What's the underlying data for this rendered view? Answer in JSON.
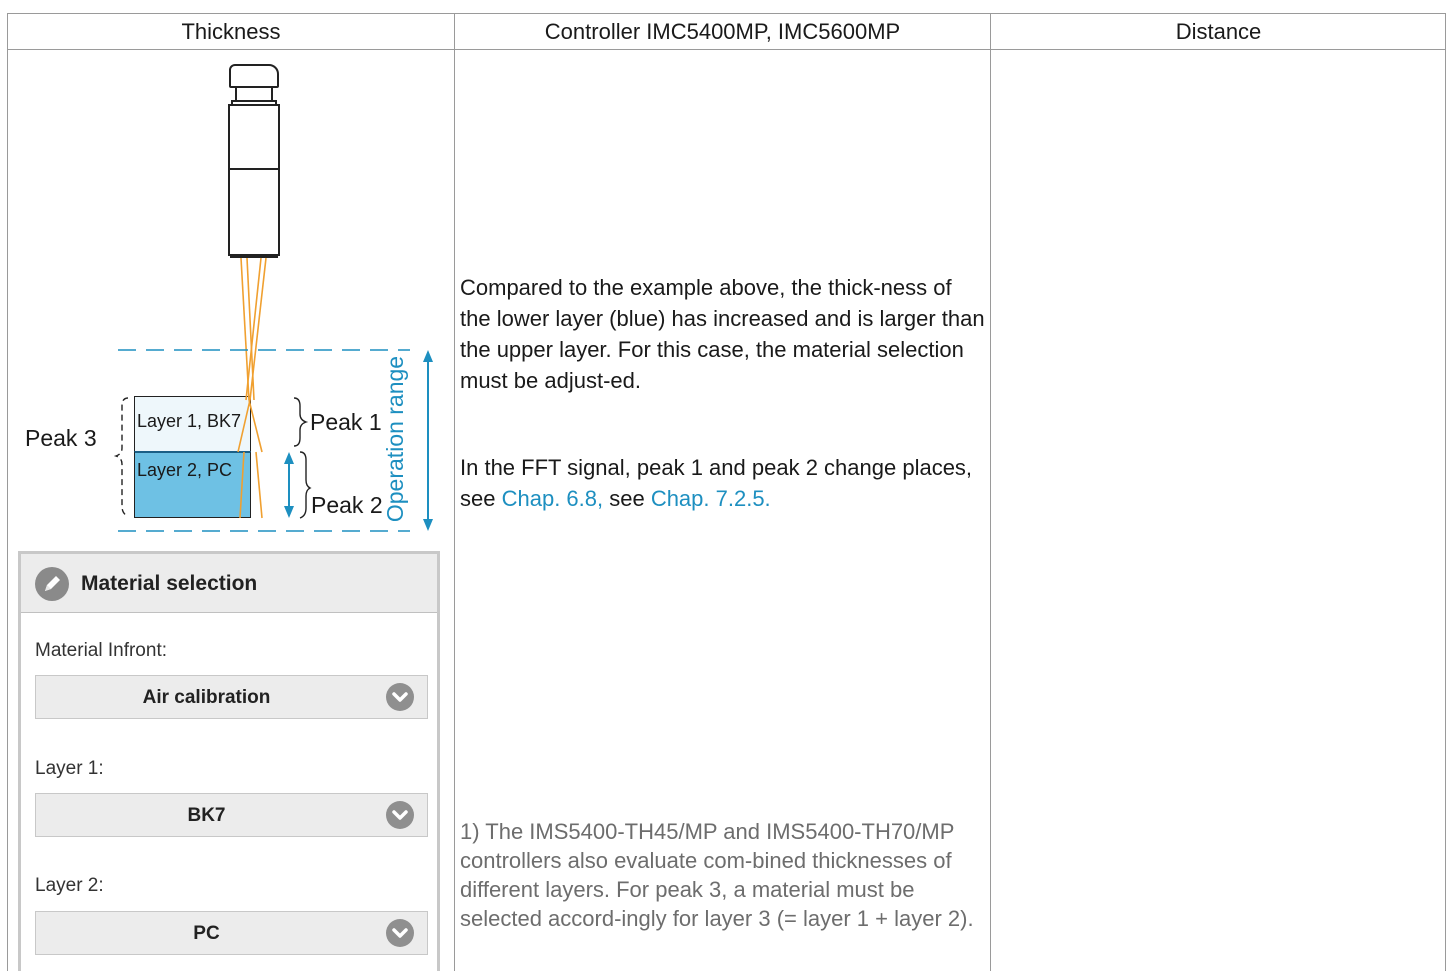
{
  "table": {
    "headers": [
      "Thickness",
      "Controller IMC5400MP, IMC5600MP",
      "Distance"
    ]
  },
  "illustration": {
    "layer1_label": "Layer 1, BK7",
    "layer2_label": "Layer 2, PC",
    "peak1": "Peak 1",
    "peak2": "Peak 2",
    "peak3": "Peak 3",
    "operation_range": "Operation range",
    "colors": {
      "layer1": "#eef7fb",
      "layer2": "#6ec1e4",
      "beam": "#f0a030",
      "range_arrow": "#1d8fc0"
    }
  },
  "material_panel": {
    "title": "Material selection",
    "icon": "pencil-icon",
    "fields": [
      {
        "label": "Material Infront:",
        "value": "Air calibration"
      },
      {
        "label": "Layer 1:",
        "value": "BK7"
      },
      {
        "label": "Layer 2:",
        "value": "PC"
      }
    ]
  },
  "description": {
    "para1": "Compared to the example above, the thick-ness of the lower layer (blue) has increased and is larger than the upper layer. For this case, the material selection must be adjust-ed.",
    "para2_text_a": "In the FFT signal, peak 1 and peak 2 change places, see ",
    "para2_link1": "Chap. 6.8,",
    "para2_text_b": " see ",
    "para2_link2": "Chap. 7.2.5.",
    "footnote": "1) The IMS5400-TH45/MP and IMS5400-TH70/MP controllers also evaluate com-bined thicknesses of different layers. For peak 3, a material must be selected accord-ingly for layer 3 (= layer 1 + layer 2)."
  }
}
